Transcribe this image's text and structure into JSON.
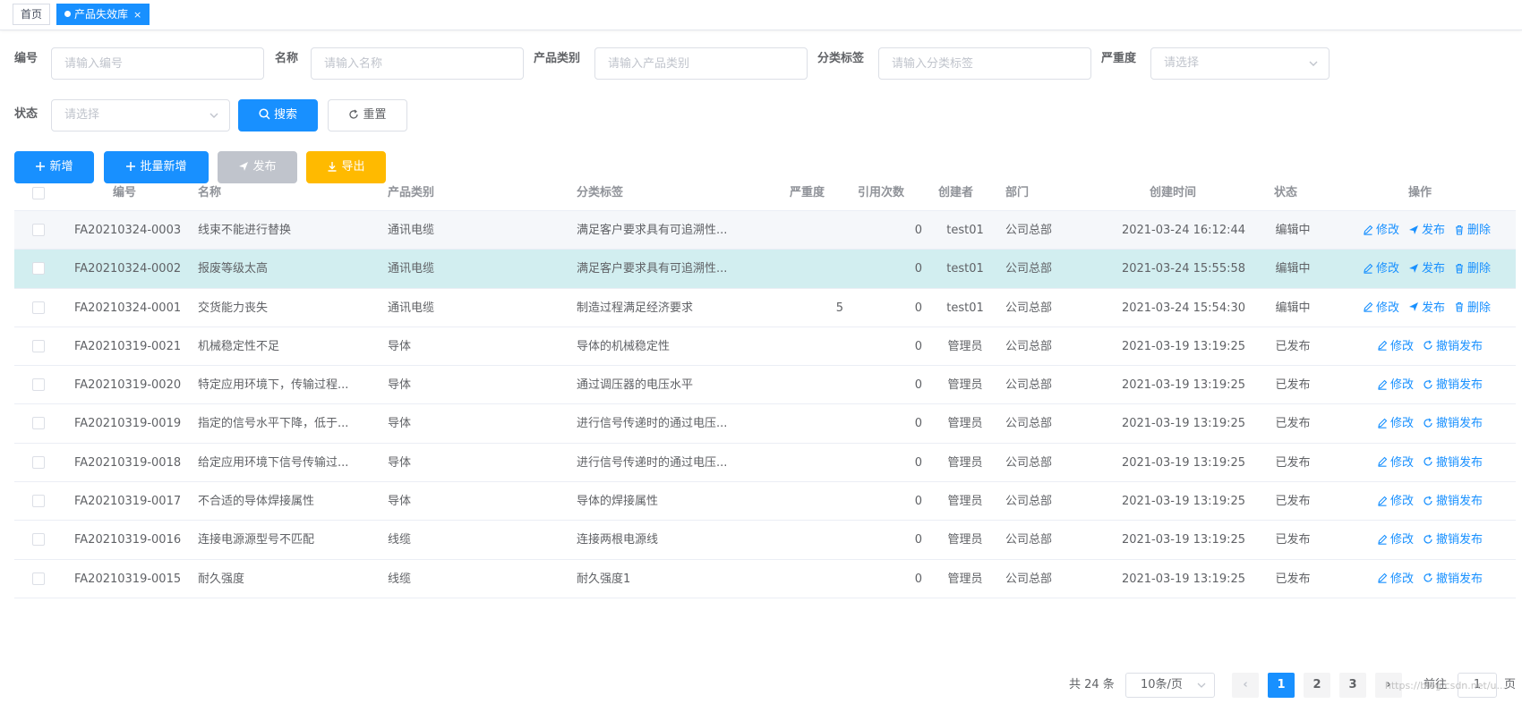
{
  "tabs": {
    "home": "首页",
    "active": "产品失效库",
    "close": "×"
  },
  "filters": {
    "code": {
      "label": "编号",
      "placeholder": "请输入编号"
    },
    "name": {
      "label": "名称",
      "placeholder": "请输入名称"
    },
    "category": {
      "label": "产品类别",
      "placeholder": "请输入产品类别"
    },
    "tag": {
      "label": "分类标签",
      "placeholder": "请输入分类标签"
    },
    "severity": {
      "label": "严重度",
      "placeholder": "请选择"
    },
    "status": {
      "label": "状态",
      "placeholder": "请选择"
    },
    "search_label": "搜索",
    "reset_label": "重置"
  },
  "toolbar": {
    "add_label": "新增",
    "batch_add_label": "批量新增",
    "publish_label": "发布",
    "export_label": "导出"
  },
  "table": {
    "headers": {
      "code": "编号",
      "name": "名称",
      "category": "产品类别",
      "tag": "分类标签",
      "severity": "严重度",
      "refs": "引用次数",
      "creator": "创建者",
      "dept": "部门",
      "created": "创建时间",
      "status": "状态",
      "ops": "操作"
    },
    "op_labels": {
      "edit": "修改",
      "publish": "发布",
      "delete": "删除",
      "revoke": "撤销发布"
    },
    "rows": [
      {
        "code": "FA20210324-0003",
        "name": "线束不能进行替换",
        "category": "通讯电缆",
        "tag": "满足客户要求具有可追溯性...",
        "severity": "",
        "refs": "0",
        "creator": "test01",
        "dept": "公司总部",
        "created": "2021-03-24 16:12:44",
        "status": "编辑中",
        "published": false,
        "state": "hover"
      },
      {
        "code": "FA20210324-0002",
        "name": "报废等级太高",
        "category": "通讯电缆",
        "tag": "满足客户要求具有可追溯性...",
        "severity": "",
        "refs": "0",
        "creator": "test01",
        "dept": "公司总部",
        "created": "2021-03-24 15:55:58",
        "status": "编辑中",
        "published": false,
        "state": "selected"
      },
      {
        "code": "FA20210324-0001",
        "name": "交货能力丧失",
        "category": "通讯电缆",
        "tag": "制造过程满足经济要求",
        "severity": "5",
        "refs": "0",
        "creator": "test01",
        "dept": "公司总部",
        "created": "2021-03-24 15:54:30",
        "status": "编辑中",
        "published": false,
        "state": ""
      },
      {
        "code": "FA20210319-0021",
        "name": "机械稳定性不足",
        "category": "导体",
        "tag": "导体的机械稳定性",
        "severity": "",
        "refs": "0",
        "creator": "管理员",
        "dept": "公司总部",
        "created": "2021-03-19 13:19:25",
        "status": "已发布",
        "published": true,
        "state": ""
      },
      {
        "code": "FA20210319-0020",
        "name": "特定应用环境下，传输过程...",
        "category": "导体",
        "tag": "通过调压器的电压水平",
        "severity": "",
        "refs": "0",
        "creator": "管理员",
        "dept": "公司总部",
        "created": "2021-03-19 13:19:25",
        "status": "已发布",
        "published": true,
        "state": ""
      },
      {
        "code": "FA20210319-0019",
        "name": "指定的信号水平下降，低于...",
        "category": "导体",
        "tag": "进行信号传递时的通过电压...",
        "severity": "",
        "refs": "0",
        "creator": "管理员",
        "dept": "公司总部",
        "created": "2021-03-19 13:19:25",
        "status": "已发布",
        "published": true,
        "state": ""
      },
      {
        "code": "FA20210319-0018",
        "name": "给定应用环境下信号传输过...",
        "category": "导体",
        "tag": "进行信号传递时的通过电压...",
        "severity": "",
        "refs": "0",
        "creator": "管理员",
        "dept": "公司总部",
        "created": "2021-03-19 13:19:25",
        "status": "已发布",
        "published": true,
        "state": ""
      },
      {
        "code": "FA20210319-0017",
        "name": "不合适的导体焊接属性",
        "category": "导体",
        "tag": "导体的焊接属性",
        "severity": "",
        "refs": "0",
        "creator": "管理员",
        "dept": "公司总部",
        "created": "2021-03-19 13:19:25",
        "status": "已发布",
        "published": true,
        "state": ""
      },
      {
        "code": "FA20210319-0016",
        "name": "连接电源源型号不匹配",
        "category": "线缆",
        "tag": "连接两根电源线",
        "severity": "",
        "refs": "0",
        "creator": "管理员",
        "dept": "公司总部",
        "created": "2021-03-19 13:19:25",
        "status": "已发布",
        "published": true,
        "state": ""
      },
      {
        "code": "FA20210319-0015",
        "name": "耐久强度",
        "category": "线缆",
        "tag": "耐久强度1",
        "severity": "",
        "refs": "0",
        "creator": "管理员",
        "dept": "公司总部",
        "created": "2021-03-19 13:19:25",
        "status": "已发布",
        "published": true,
        "state": ""
      }
    ]
  },
  "pagination": {
    "total": "共 24 条",
    "page_size": "10条/页",
    "prev": "‹",
    "pages": [
      "1",
      "2",
      "3"
    ],
    "next": "›",
    "goto_prefix": "前往",
    "goto_value": "1",
    "goto_suffix": "页"
  },
  "watermark": "https://blog.csdn.net/u...",
  "colors": {
    "primary": "#1890ff",
    "warning": "#ffba00",
    "disabled": "#c0c4cc",
    "selected_row": "#d2eef0"
  }
}
